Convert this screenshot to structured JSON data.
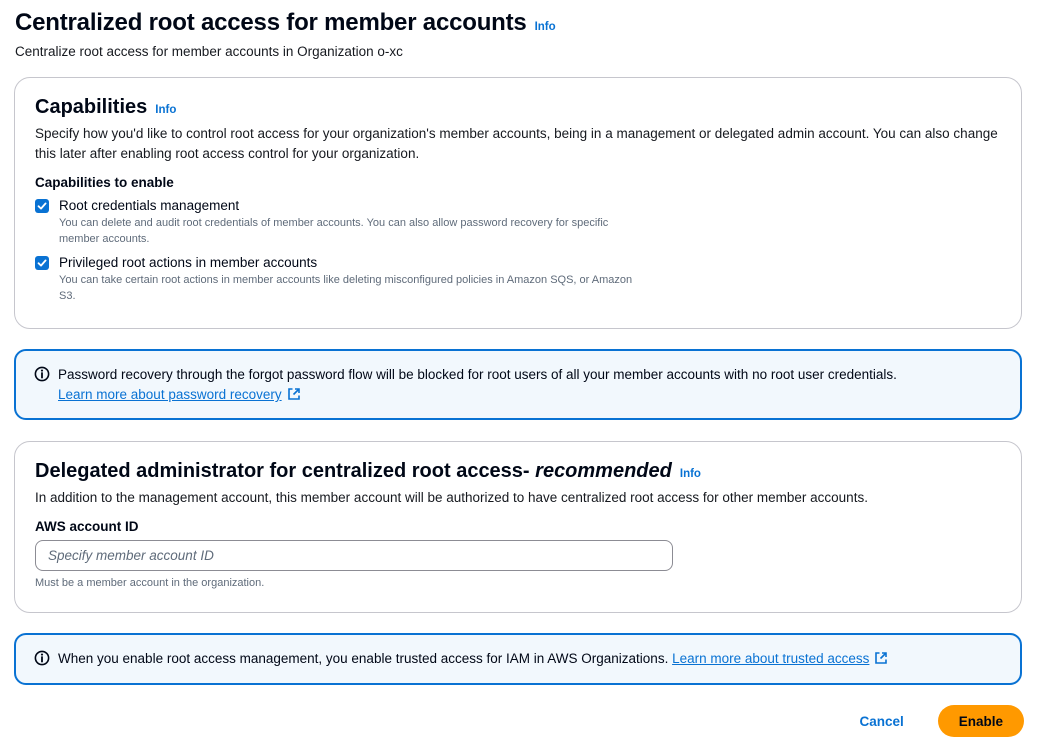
{
  "header": {
    "title": "Centralized root access for member accounts",
    "info": "Info",
    "description": "Centralize root access for member accounts in Organization o-xc"
  },
  "capabilities": {
    "title": "Capabilities",
    "info": "Info",
    "description": "Specify how you'd like to control root access for your organization's member accounts, being in a management or delegated admin account. You can also change this later after enabling root access control for your organization.",
    "field_label": "Capabilities to enable",
    "options": [
      {
        "label": "Root credentials management",
        "description": "You can delete and audit root credentials of member accounts. You can also allow password recovery for specific member accounts.",
        "checked": true
      },
      {
        "label": "Privileged root actions in member accounts",
        "description": "You can take certain root actions in member accounts like deleting misconfigured policies in Amazon SQS, or Amazon S3.",
        "checked": true
      }
    ]
  },
  "password_alert": {
    "icon": "info-circle-icon",
    "message": "Password recovery through the forgot password flow will be blocked for root users of all your member accounts with no root user credentials.",
    "link": "Learn more about password recovery"
  },
  "delegated_admin": {
    "title": "Delegated administrator for centralized root access- ",
    "title_emphasis": "recommended",
    "info": "Info",
    "description": "In addition to the management account, this member account will be authorized to have centralized root access for other member accounts.",
    "field_label": "AWS account ID",
    "input_value": "",
    "input_placeholder": "Specify member account ID",
    "constraint": "Must be a member account in the organization."
  },
  "trusted_alert": {
    "icon": "info-circle-icon",
    "message": "When you enable root access management, you enable trusted access for IAM in AWS Organizations. ",
    "link": "Learn more about trusted access"
  },
  "actions": {
    "cancel": "Cancel",
    "enable": "Enable"
  },
  "colors": {
    "link_blue": "#0972d3",
    "primary_orange": "#ff9900",
    "alert_background": "#f2f8fd"
  }
}
